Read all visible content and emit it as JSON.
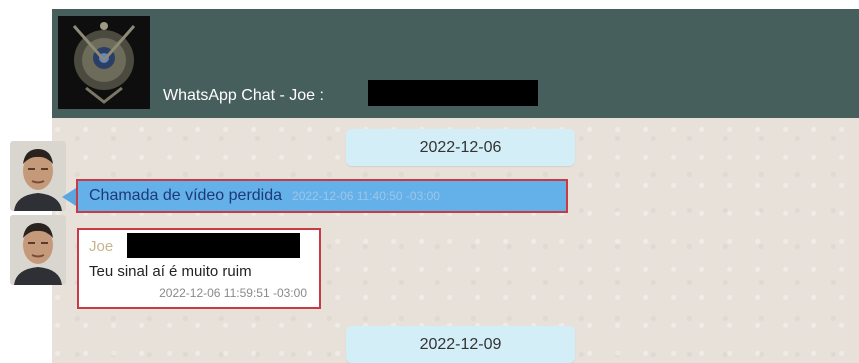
{
  "header": {
    "title": "WhatsApp Chat - Joe :"
  },
  "dates": [
    "2022-12-06",
    "2022-12-09"
  ],
  "messages": [
    {
      "type": "missed-video-call",
      "text": "Chamada de vídeo perdida",
      "time": "2022-12-06 11:40:50 -03:00"
    },
    {
      "type": "text",
      "sender": "Joe",
      "text": "Teu sinal aí é muito ruim",
      "time": "2022-12-06 11:59:51 -03:00"
    }
  ],
  "colors": {
    "header": "#465f5d",
    "date_pill": "#d4eef8",
    "missed_call": "#64b0e8",
    "highlight_border": "#c73b45"
  }
}
